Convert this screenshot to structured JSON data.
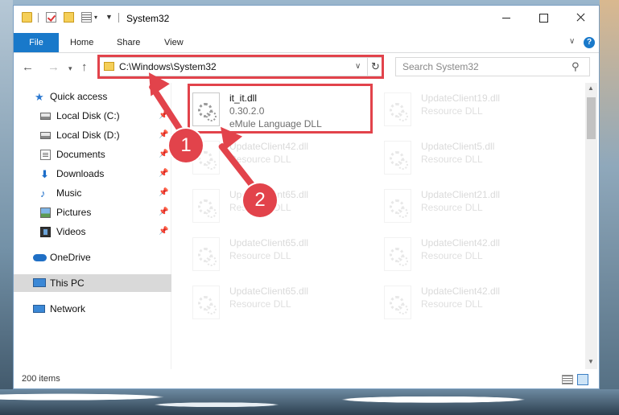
{
  "window": {
    "title": "System32",
    "ribbon_tabs": [
      "File",
      "Home",
      "Share",
      "View"
    ],
    "help_label": "?"
  },
  "address": {
    "path": "C:\\Windows\\System32",
    "search_placeholder": "Search System32"
  },
  "sidebar": {
    "items": [
      {
        "label": "Quick access",
        "icon": "star-icon",
        "pinned": false
      },
      {
        "label": "Local Disk (C:)",
        "icon": "disk-icon",
        "pinned": true
      },
      {
        "label": "Local Disk (D:)",
        "icon": "disk-icon",
        "pinned": true
      },
      {
        "label": "Documents",
        "icon": "documents-icon",
        "pinned": true
      },
      {
        "label": "Downloads",
        "icon": "downloads-icon",
        "pinned": true
      },
      {
        "label": "Music",
        "icon": "music-icon",
        "pinned": true
      },
      {
        "label": "Pictures",
        "icon": "pictures-icon",
        "pinned": true
      },
      {
        "label": "Videos",
        "icon": "videos-icon",
        "pinned": true
      },
      {
        "label": "OneDrive",
        "icon": "onedrive-icon",
        "pinned": false
      },
      {
        "label": "This PC",
        "icon": "this-pc-icon",
        "pinned": false,
        "selected": true
      },
      {
        "label": "Network",
        "icon": "network-icon",
        "pinned": false
      }
    ]
  },
  "files": [
    {
      "name": "it_it.dll",
      "line2": "0.30.2.0",
      "line3": "eMule Language DLL",
      "highlighted": true
    },
    {
      "name": "UpdateClient19.dll",
      "line2": "Resource DLL"
    },
    {
      "name": "UpdateClient42.dll",
      "line2": "Resource DLL"
    },
    {
      "name": "UpdateClient5.dll",
      "line2": "Resource DLL"
    },
    {
      "name": "UpdateClient65.dll",
      "line2": "Resource DLL"
    },
    {
      "name": "UpdateClient21.dll",
      "line2": "Resource DLL"
    },
    {
      "name": "UpdateClient65.dll",
      "line2": "Resource DLL"
    },
    {
      "name": "UpdateClient42.dll",
      "line2": "Resource DLL"
    },
    {
      "name": "UpdateClient65.dll",
      "line2": "Resource DLL"
    },
    {
      "name": "UpdateClient42.dll",
      "line2": "Resource DLL"
    }
  ],
  "status": {
    "item_count": "200 items"
  },
  "annotations": {
    "step1": "1",
    "step2": "2",
    "color": "#e2434b"
  },
  "colors": {
    "accent": "#1979ca",
    "selection": "#d9d9d9"
  }
}
